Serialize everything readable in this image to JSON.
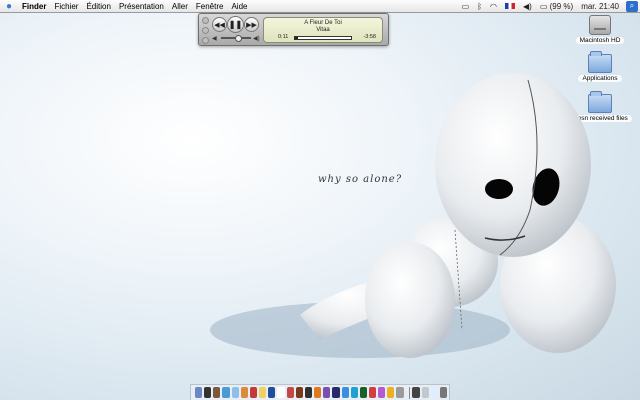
{
  "menubar": {
    "apple_icon": "apple-icon",
    "items": [
      "Finder",
      "Fichier",
      "Édition",
      "Présentation",
      "Aller",
      "Fenêtre",
      "Aide"
    ],
    "status": {
      "battery": "(99 %)",
      "clock": "mar. 21:40",
      "icons": [
        "display-icon",
        "bluetooth-icon",
        "wifi-icon",
        "flag-fr-icon",
        "volume-icon",
        "battery-icon",
        "spotlight-icon"
      ]
    }
  },
  "player": {
    "song_title": "A Fleur De Toi",
    "artist": "Vitaa",
    "elapsed": "0:11",
    "remaining": "-3:58",
    "progress": 0.05,
    "volume": 0.55
  },
  "desktop": {
    "icons": [
      {
        "label": "Macintosh HD",
        "type": "hard-drive-icon"
      },
      {
        "label": "Applications",
        "type": "folder-icon"
      },
      {
        "label": "amsn received files",
        "type": "folder-icon"
      }
    ],
    "wallpaper_text": "why so alone?"
  },
  "dock": {
    "colors": [
      "#6a87c8",
      "#333333",
      "#7a5a3a",
      "#4a9ad6",
      "#8fbfe8",
      "#d98a3a",
      "#c23b3b",
      "#f0d060",
      "#1e4f9a",
      "#ffffff",
      "#c44848",
      "#7a3a1a",
      "#2f2f2f",
      "#e07a1a",
      "#7b4fb0",
      "#2a2a6a",
      "#3b8fe0",
      "#20a0d0",
      "#1a5f2a",
      "#d04040",
      "#b45ad0",
      "#ecb020",
      "#9a9a9a",
      "#444444",
      "#c0c8d0",
      "#ddeeff",
      "#777777"
    ]
  }
}
